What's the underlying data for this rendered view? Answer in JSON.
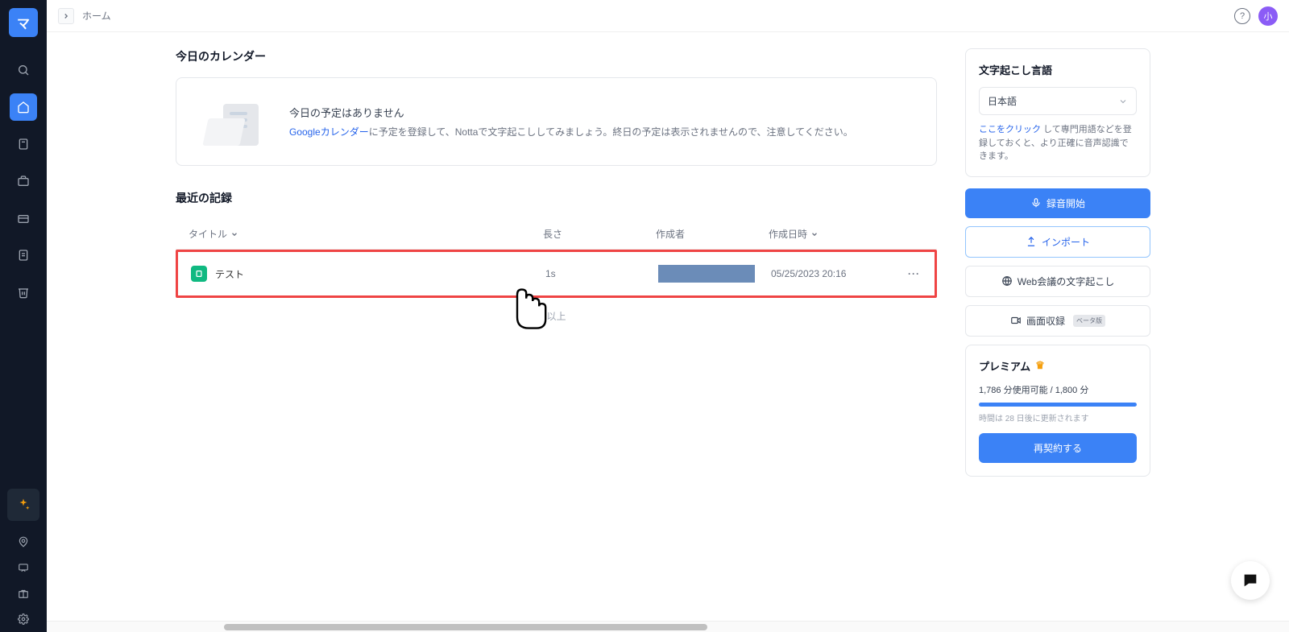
{
  "app": {
    "logo_text": "マ",
    "breadcrumb": "ホーム",
    "avatar_text": "小"
  },
  "sidebar": {
    "items": [
      {
        "name": "search-icon"
      },
      {
        "name": "home-icon",
        "active": true
      },
      {
        "name": "bookmark-icon"
      },
      {
        "name": "briefcase-icon"
      },
      {
        "name": "layers-icon"
      },
      {
        "name": "document-icon"
      },
      {
        "name": "trash-icon"
      }
    ],
    "bottom_items": [
      {
        "name": "pin-icon"
      },
      {
        "name": "chat-icon"
      },
      {
        "name": "gift-icon"
      },
      {
        "name": "settings-icon"
      }
    ]
  },
  "calendar": {
    "section_title": "今日のカレンダー",
    "no_event": "今日の予定はありません",
    "link_text": "Googleカレンダー",
    "desc_rest": "に予定を登録して、Nottaで文字起こししてみましょう。終日の予定は表示されませんので、注意してください。"
  },
  "records": {
    "section_title": "最近の記録",
    "headers": {
      "title": "タイトル",
      "length": "長さ",
      "author": "作成者",
      "date": "作成日時"
    },
    "items": [
      {
        "title": "テスト",
        "length": "1s",
        "date": "05/25/2023 20:16"
      }
    ],
    "end": "以上"
  },
  "lang_panel": {
    "title": "文字起こし言語",
    "selected": "日本語",
    "hint_link": "ここをクリック",
    "hint_rest": " して専門用語などを登録しておくと、より正確に音声認識できます。"
  },
  "actions": {
    "record": "録音開始",
    "import": "インポート",
    "web": "Web会議の文字起こし",
    "screen": "画面収録",
    "beta": "ベータ版"
  },
  "premium": {
    "title": "プレミアム",
    "usage": "1,786 分使用可能 / 1,800 分",
    "refresh": "時間は 28 日後に更新されます",
    "renew": "再契約する"
  }
}
